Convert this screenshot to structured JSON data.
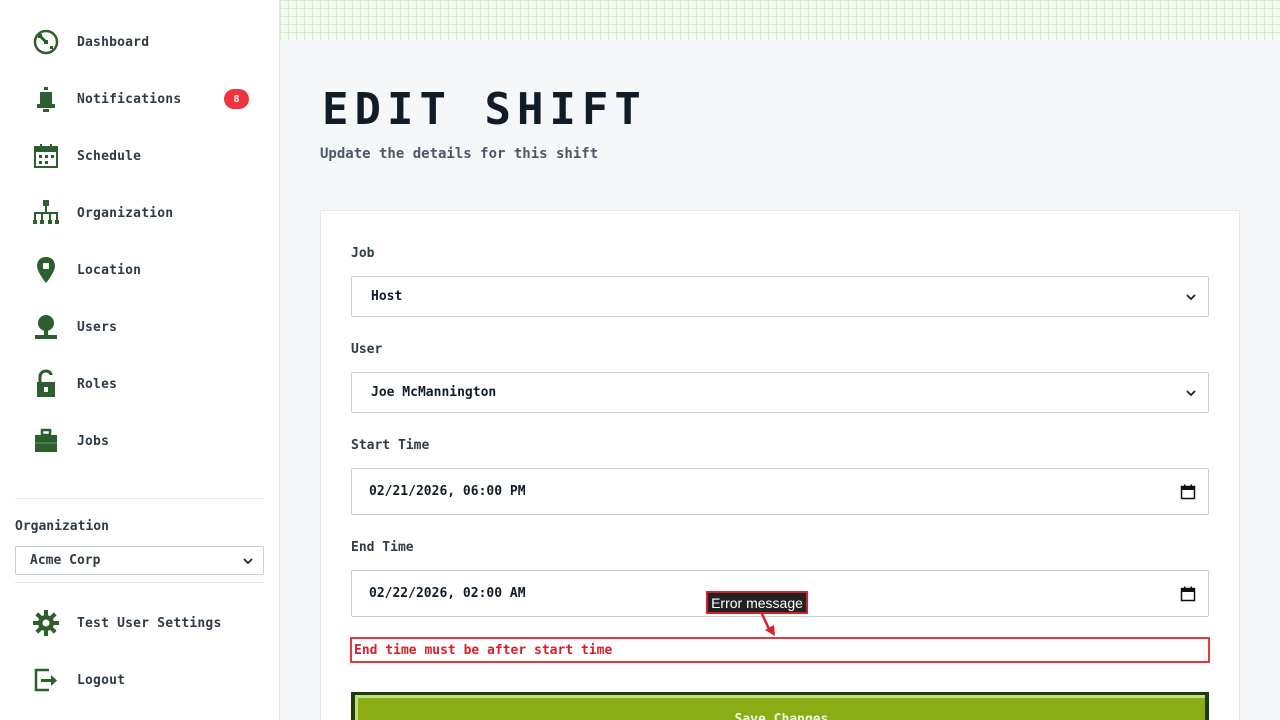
{
  "sidebar": {
    "items": [
      {
        "label": "Dashboard",
        "icon": "dashboard-icon"
      },
      {
        "label": "Notifications",
        "icon": "bell-icon",
        "badge": "8"
      },
      {
        "label": "Schedule",
        "icon": "calendar-icon"
      },
      {
        "label": "Organization",
        "icon": "org-chart-icon"
      },
      {
        "label": "Location",
        "icon": "location-pin-icon"
      },
      {
        "label": "Users",
        "icon": "user-icon"
      },
      {
        "label": "Roles",
        "icon": "unlock-icon"
      },
      {
        "label": "Jobs",
        "icon": "briefcase-icon"
      }
    ],
    "organization_label": "Organization",
    "organization_value": "Acme Corp",
    "settings_label": "Test User Settings",
    "logout_label": "Logout"
  },
  "page": {
    "title": "EDIT SHIFT",
    "subtitle": "Update the details for this shift"
  },
  "form": {
    "job_label": "Job",
    "job_value": "Host",
    "user_label": "User",
    "user_value": "Joe McMannington",
    "start_label": "Start Time",
    "start_value": "02/21/2026, 06:00 PM",
    "end_label": "End Time",
    "end_value": "02/22/2026, 02:00 AM",
    "error_text": "End time must be after start time",
    "save_label": "Save Changes"
  },
  "annotation": {
    "label": "Error message"
  },
  "colors": {
    "icon_green": "#2d5e2e",
    "error_red": "#e8353e",
    "badge_red": "#ef3340",
    "button_green": "#8aac14",
    "button_border": "#1f3d0c"
  }
}
